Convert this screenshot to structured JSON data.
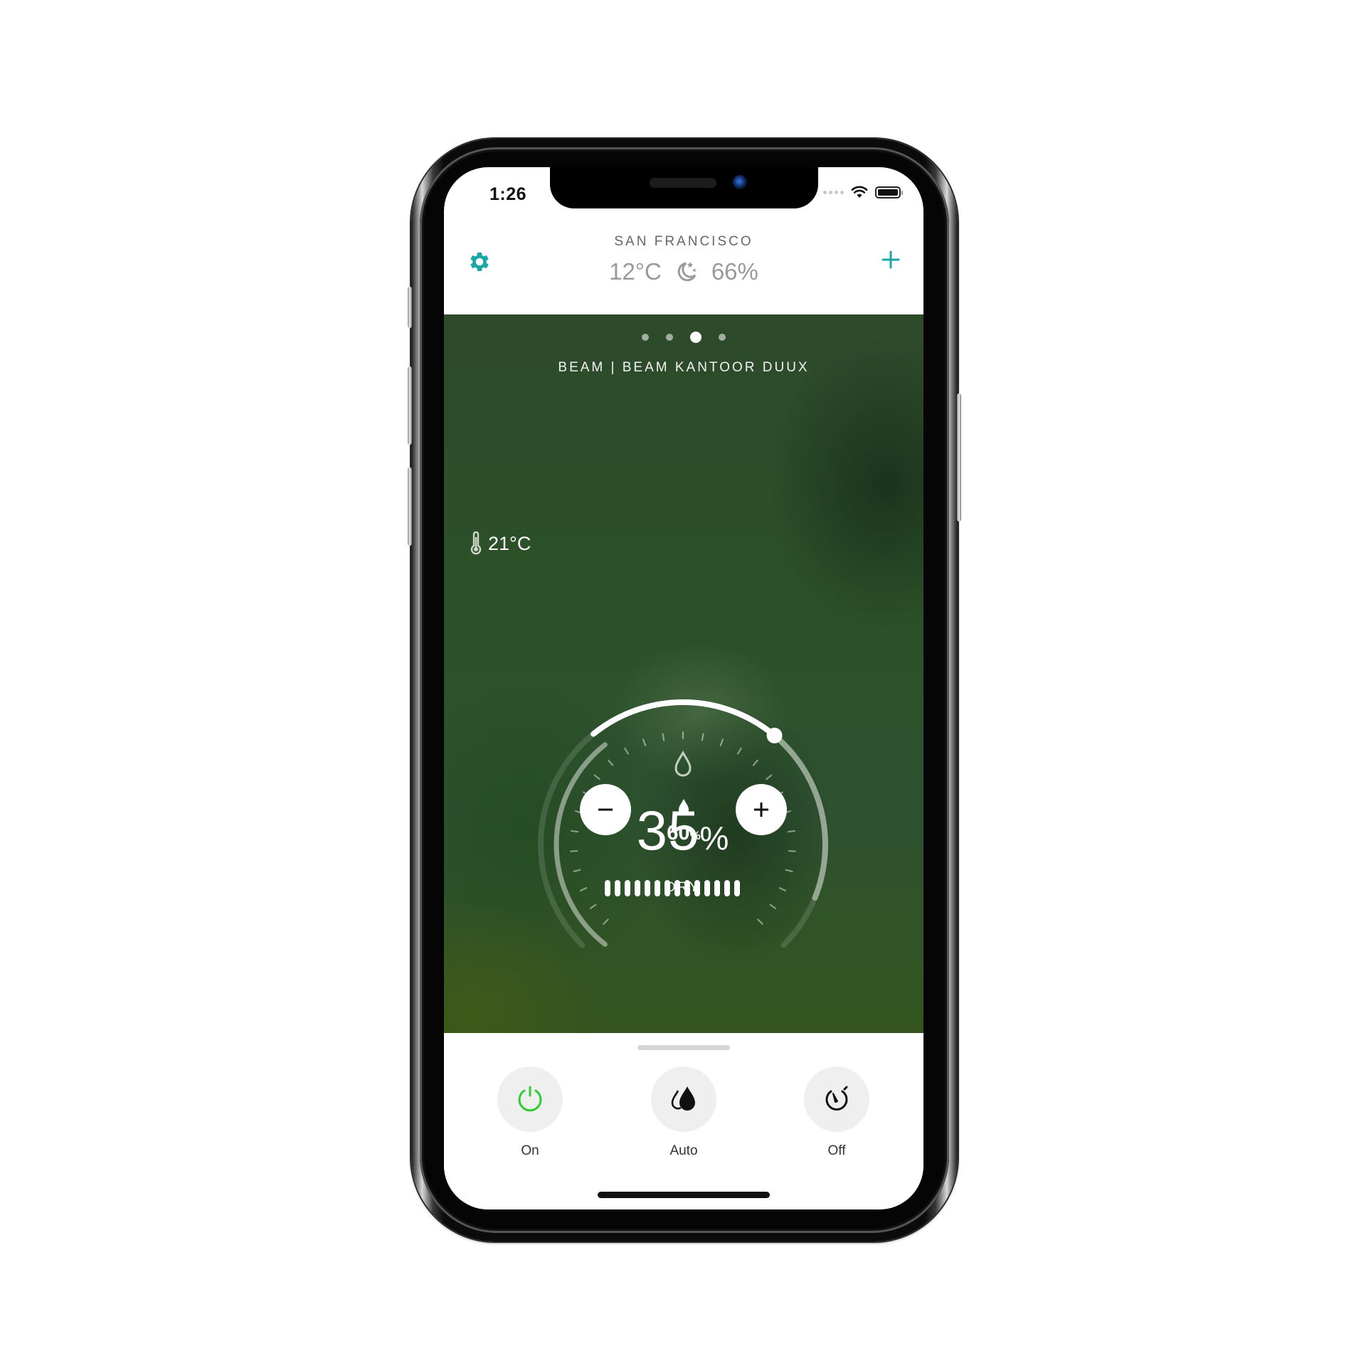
{
  "status_bar": {
    "time": "1:26",
    "icons": [
      "signal-dots-icon",
      "wifi-icon",
      "battery-icon"
    ]
  },
  "header": {
    "location": "SAN FRANCISCO",
    "outdoor_temperature": "12°C",
    "weather_icon": "moon-stars-icon",
    "outdoor_humidity": "66%",
    "left_icon": "gear-icon",
    "right_icon": "plus-icon",
    "accent_color": "#1aa6a6"
  },
  "device": {
    "page_count": 4,
    "active_page": 3,
    "name": "BEAM | BEAM KANTOOR DUUX",
    "indoor_temperature": "21°C",
    "current_humidity_value": "35",
    "current_humidity_unit": "%",
    "humidity_status": "DRY",
    "target_humidity_value": "60",
    "target_humidity_unit": "%",
    "target_humidity_fraction": 0.6,
    "decrease_label": "−",
    "increase_label": "+",
    "level_segments": 14
  },
  "actions": [
    {
      "label": "On",
      "icon": "power-icon",
      "color": "#2ecc2e"
    },
    {
      "label": "Auto",
      "icon": "water-drops-icon",
      "color": "#111111"
    },
    {
      "label": "Off",
      "icon": "timer-icon",
      "color": "#111111"
    }
  ]
}
